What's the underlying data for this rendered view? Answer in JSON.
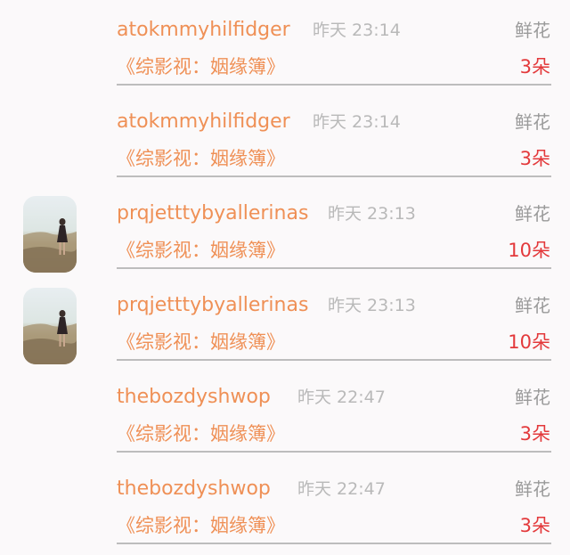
{
  "records": [
    {
      "user": "atokmmyhilfidger",
      "time": "昨天 23:14",
      "gift": "鲜花",
      "book": "《综影视：姻缘簿》",
      "count": "3朵",
      "avatar": false
    },
    {
      "user": "atokmmyhilfidger",
      "time": "昨天 23:14",
      "gift": "鲜花",
      "book": "《综影视：姻缘簿》",
      "count": "3朵",
      "avatar": false
    },
    {
      "user": "prqjetttybyallerinas",
      "time": "昨天 23:13",
      "gift": "鲜花",
      "book": "《综影视：姻缘簿》",
      "count": "10朵",
      "avatar": true
    },
    {
      "user": "prqjetttybyallerinas",
      "time": "昨天 23:13",
      "gift": "鲜花",
      "book": "《综影视：姻缘簿》",
      "count": "10朵",
      "avatar": true
    },
    {
      "user": "thebozdyshwop",
      "time": "昨天 22:47",
      "gift": "鲜花",
      "book": "《综影视：姻缘簿》",
      "count": "3朵",
      "avatar": false
    },
    {
      "user": "thebozdyshwop",
      "time": "昨天 22:47",
      "gift": "鲜花",
      "book": "《综影视：姻缘簿》",
      "count": "3朵",
      "avatar": false
    }
  ]
}
